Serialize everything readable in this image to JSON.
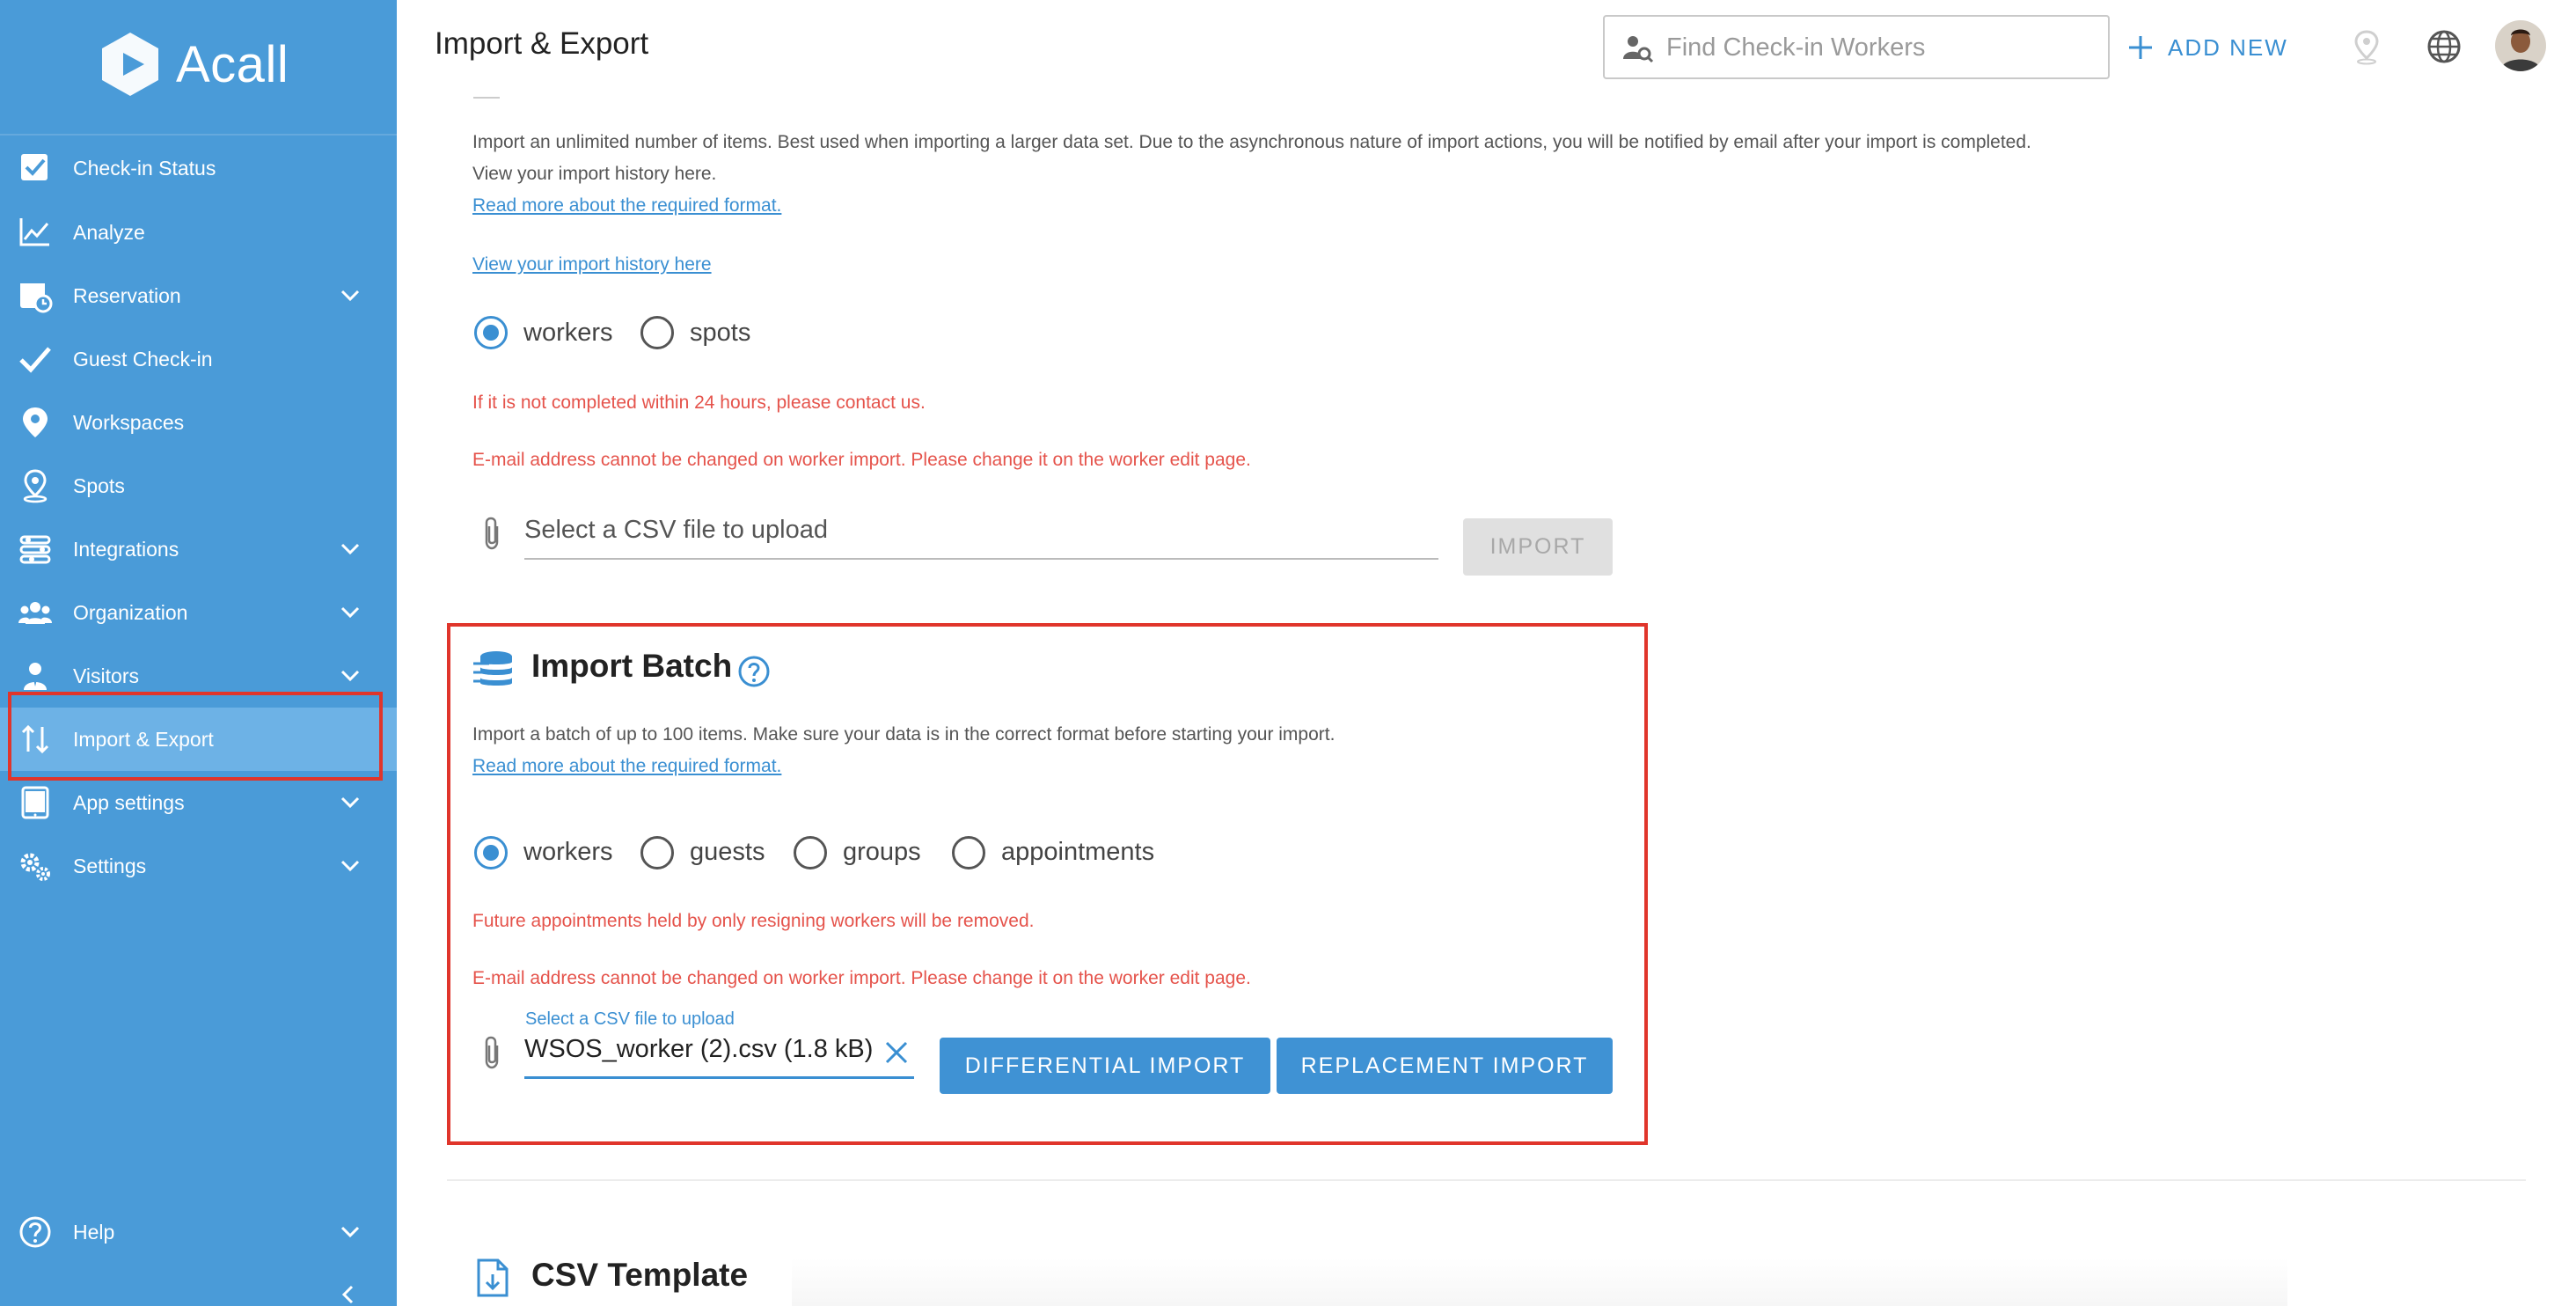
{
  "app": {
    "brand": "Acall"
  },
  "header": {
    "title": "Import & Export",
    "search_placeholder": "Find Check-in Workers",
    "add_new_label": "ADD NEW"
  },
  "sidebar": {
    "items": [
      {
        "label": "Check-in Status",
        "icon": "checkbox-icon",
        "has_chevron": false
      },
      {
        "label": "Analyze",
        "icon": "line-chart-icon",
        "has_chevron": false
      },
      {
        "label": "Reservation",
        "icon": "calendar-clock-icon",
        "has_chevron": true
      },
      {
        "label": "Guest Check-in",
        "icon": "checkmark-icon",
        "has_chevron": false
      },
      {
        "label": "Workspaces",
        "icon": "map-pin-icon",
        "has_chevron": false
      },
      {
        "label": "Spots",
        "icon": "location-spot-icon",
        "has_chevron": false
      },
      {
        "label": "Integrations",
        "icon": "integrations-icon",
        "has_chevron": true
      },
      {
        "label": "Organization",
        "icon": "people-group-icon",
        "has_chevron": true
      },
      {
        "label": "Visitors",
        "icon": "visitor-icon",
        "has_chevron": true
      },
      {
        "label": "Import & Export",
        "icon": "import-export-icon",
        "has_chevron": false,
        "active": true
      },
      {
        "label": "App settings",
        "icon": "tablet-icon",
        "has_chevron": true
      },
      {
        "label": "Settings",
        "icon": "gears-icon",
        "has_chevron": true
      }
    ],
    "help_label": "Help"
  },
  "import_bulk": {
    "description_line1": "Import an unlimited number of items. Best used when importing a larger data set. Due to the asynchronous nature of import actions, you will be notified by email after your import is completed.",
    "description_line2": "View your import history here.",
    "format_link": "Read more about the required format.",
    "history_link": "View your import history here",
    "options": [
      "workers",
      "spots"
    ],
    "selected": "workers",
    "warning_1": "If it is not completed within 24 hours, please contact us.",
    "warning_2": "E-mail address cannot be changed on worker import. Please change it on the worker edit page.",
    "file_placeholder": "Select a CSV file to upload",
    "import_button": "IMPORT"
  },
  "import_batch": {
    "title": "Import Batch",
    "description": "Import a batch of up to 100 items. Make sure your data is in the correct format before starting your import.",
    "format_link": "Read more about the required format.",
    "options": [
      "workers",
      "guests",
      "groups",
      "appointments"
    ],
    "selected": "workers",
    "warning_1": "Future appointments held by only resigning workers will be removed.",
    "warning_2": "E-mail address cannot be changed on worker import. Please change it on the worker edit page.",
    "file_label": "Select a CSV file to upload",
    "file_value": "WSOS_worker (2).csv (1.8 kB)",
    "differential_button": "DIFFERENTIAL IMPORT",
    "replacement_button": "REPLACEMENT IMPORT"
  },
  "csv_template": {
    "title": "CSV Template"
  },
  "colors": {
    "sidebar": "#4a9bd8",
    "accent": "#3a8fd2",
    "warning": "#e5534b",
    "highlight": "#e0352b"
  }
}
